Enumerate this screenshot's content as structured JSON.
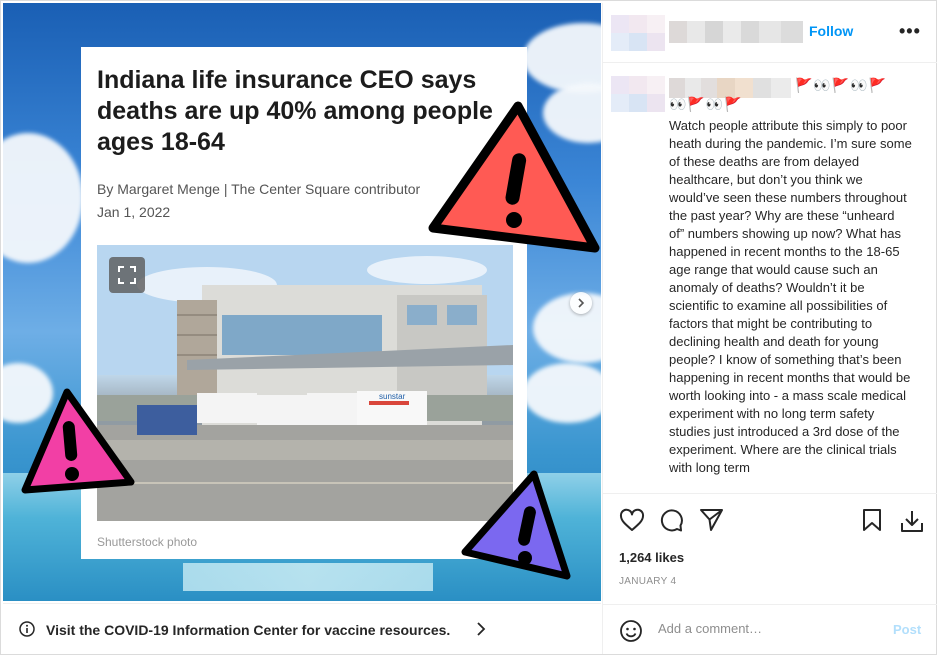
{
  "article": {
    "headline": "Indiana life insurance CEO says deaths are up 40% among people ages 18-64",
    "byline": "By Margaret Menge | The Center Square contributor",
    "date": "Jan 1, 2022",
    "photo_credit": "Shutterstock photo",
    "ambulance_brand": "sunstar"
  },
  "header": {
    "follow_label": "Follow",
    "more_label": "•••"
  },
  "caption": {
    "emoji_line1": "🚩👀🚩👀🚩",
    "emoji_line2": "👀🚩👀🚩",
    "text": "Watch people attribute this simply to poor heath during the pandemic. I’m sure some of these deaths are from delayed healthcare, but don’t you think we would’ve seen these numbers throughout the past year? Why are these “unheard of” numbers showing up now? What has happened in recent months to the 18-65 age range that would cause such an anomaly of deaths? Wouldn’t it be scientific to examine all possibilities of factors that might be contributing to declining health and death for young people? I know of something that’s been happening in recent months that would be worth looking into - a mass scale medical experiment with no long term safety studies just introduced a 3rd dose of the experiment. Where are the clinical trials with long term"
  },
  "stats": {
    "likes": "1,264 likes",
    "date": "JANUARY 4"
  },
  "comment_box": {
    "placeholder": "Add a comment…",
    "post_label": "Post"
  },
  "covid_bar": {
    "text": "Visit the COVID-19 Information Center for vaccine resources."
  },
  "icons": [
    "heart-icon",
    "comment-icon",
    "share-icon",
    "save-icon",
    "download-icon",
    "emoji-icon",
    "info-icon",
    "chevron-right-icon",
    "expand-icon",
    "warning-icon"
  ],
  "colors": {
    "accent": "#0095f6",
    "post_disabled": "#b2dffc",
    "warning_red": "#ff5a54",
    "warning_pink": "#f23fa5",
    "warning_purple": "#7b68f0"
  }
}
